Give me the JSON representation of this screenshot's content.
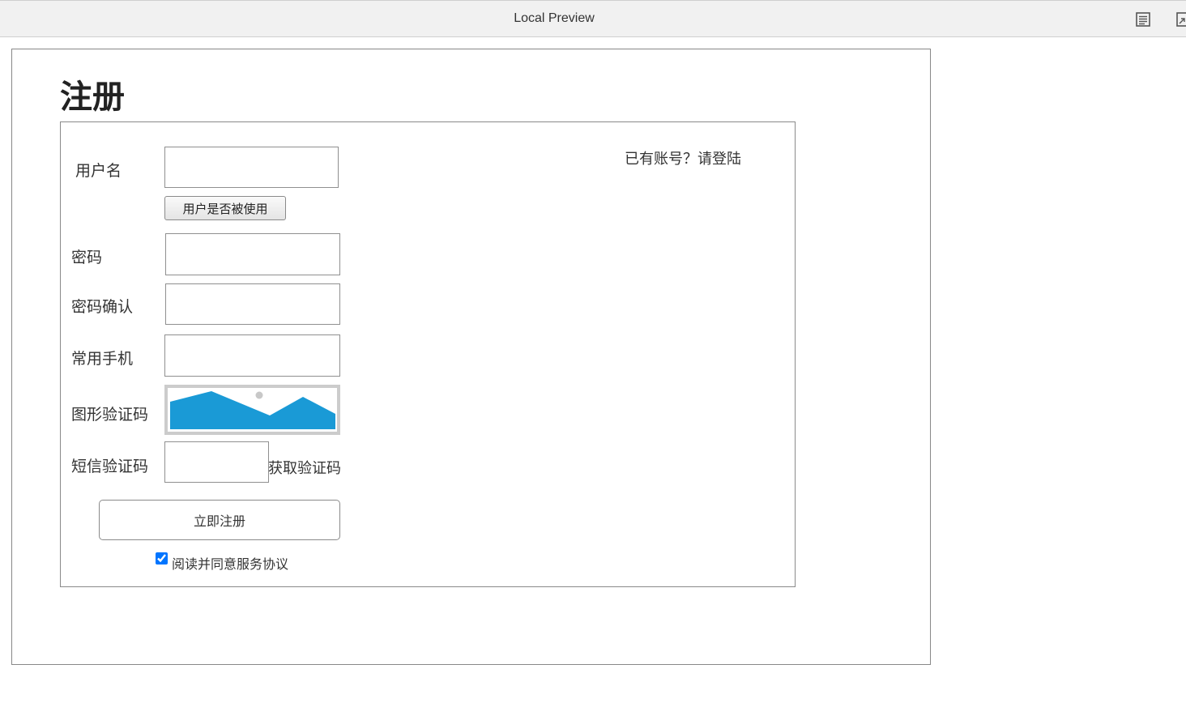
{
  "topbar": {
    "title": "Local Preview",
    "icons": [
      "reader-icon",
      "expand-icon"
    ]
  },
  "page": {
    "title": "注册"
  },
  "form": {
    "login_link": "已有账号？请登陆",
    "username": {
      "label": "用户名",
      "value": "",
      "check_button": "用户是否被使用"
    },
    "password": {
      "label": "密码",
      "value": ""
    },
    "password_confirm": {
      "label": "密码确认",
      "value": ""
    },
    "phone": {
      "label": "常用手机",
      "value": ""
    },
    "image_captcha": {
      "label": "图形验证码",
      "icon": "image-placeholder-icon"
    },
    "sms_code": {
      "label": "短信验证码",
      "value": "",
      "get_code": "获取验证码"
    },
    "submit": "立即注册",
    "agreement": {
      "label": "阅读并同意服务协议",
      "checked": true
    }
  },
  "colors": {
    "captcha_blue": "#1a9ad6",
    "border": "#8a8a8a"
  }
}
